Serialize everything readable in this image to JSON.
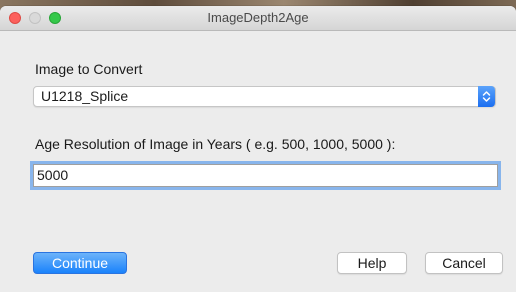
{
  "window": {
    "title": "ImageDepth2Age"
  },
  "form": {
    "image_label": "Image to Convert",
    "image_selected": "U1218_Splice",
    "resolution_label": "Age Resolution of Image in Years ( e.g. 500, 1000, 5000 ):",
    "resolution_value": "5000"
  },
  "buttons": {
    "continue": "Continue",
    "help": "Help",
    "cancel": "Cancel"
  },
  "colors": {
    "accent": "#1a82fb",
    "close": "#fc605c",
    "maximize": "#34c84a"
  },
  "icons": [
    "close-icon",
    "minimize-icon",
    "maximize-icon",
    "updown-chevron-icon"
  ]
}
